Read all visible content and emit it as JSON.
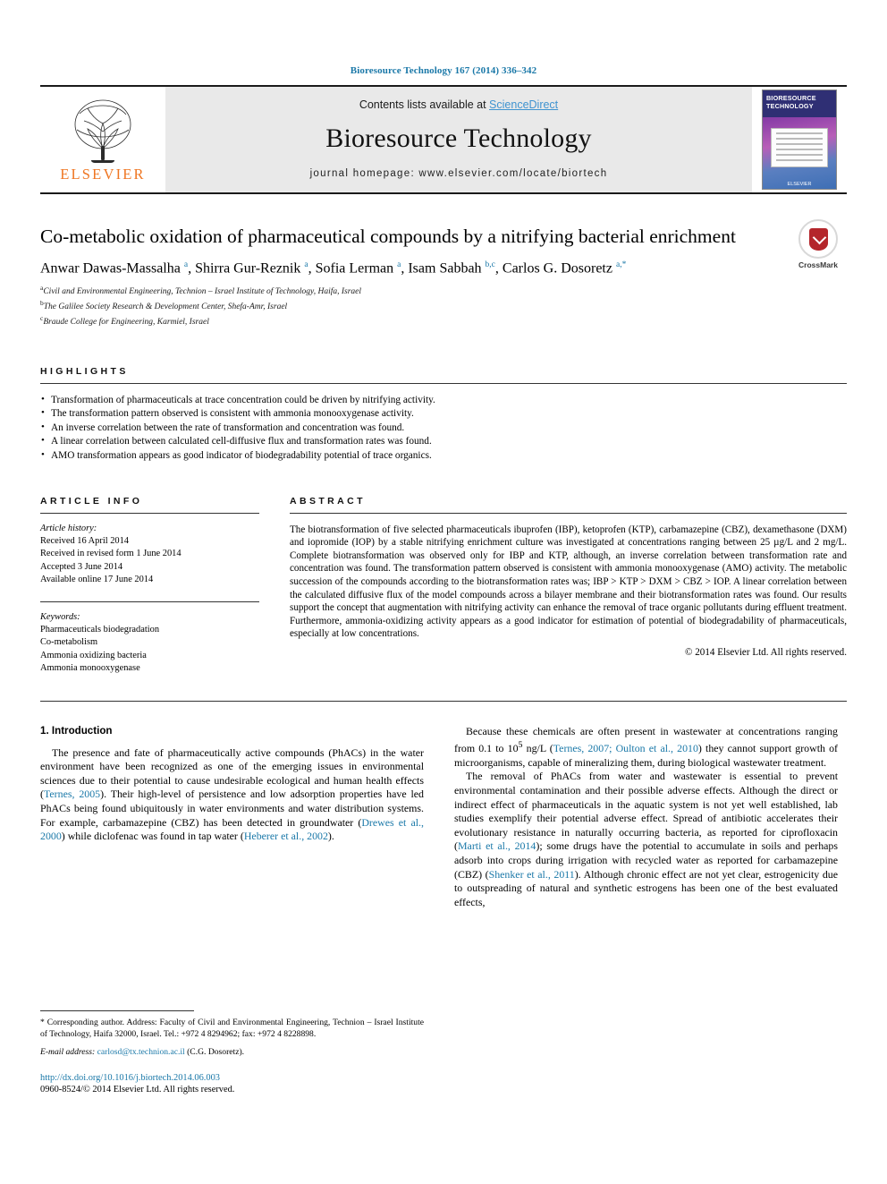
{
  "running_head": "Bioresource Technology 167 (2014) 336–342",
  "masthead": {
    "contents_prefix": "Contents lists available at ",
    "sciencedirect": "ScienceDirect",
    "journal_name": "Bioresource Technology",
    "homepage": "journal homepage: www.elsevier.com/locate/biortech",
    "publisher": "ELSEVIER",
    "cover_title": "BIORESOURCE TECHNOLOGY",
    "cover_footer": "ELSEVIER"
  },
  "article": {
    "title": "Co-metabolic oxidation of pharmaceutical compounds by a nitrifying bacterial enrichment",
    "crossmark_label": "CrossMark",
    "authors_html": "Anwar Dawas-Massalha <sup>a</sup>, Shirra Gur-Reznik <sup>a</sup>, Sofia Lerman <sup>a</sup>, Isam Sabbah <sup>b,c</sup>, Carlos G. Dosoretz <sup>a,</sup><sup class=\"star\">*</sup>",
    "affiliations": [
      {
        "marker": "a",
        "text": "Civil and Environmental Engineering, Technion – Israel Institute of Technology, Haifa, Israel"
      },
      {
        "marker": "b",
        "text": "The Galilee Society Research & Development Center, Shefa-Amr, Israel"
      },
      {
        "marker": "c",
        "text": "Braude College for Engineering, Karmiel, Israel"
      }
    ]
  },
  "highlights": {
    "heading": "HIGHLIGHTS",
    "items": [
      "Transformation of pharmaceuticals at trace concentration could be driven by nitrifying activity.",
      "The transformation pattern observed is consistent with ammonia monooxygenase activity.",
      "An inverse correlation between the rate of transformation and concentration was found.",
      "A linear correlation between calculated cell-diffusive flux and transformation rates was found.",
      "AMO transformation appears as good indicator of biodegradability potential of trace organics."
    ]
  },
  "article_info": {
    "heading": "ARTICLE INFO",
    "history_label": "Article history:",
    "history": [
      "Received 16 April 2014",
      "Received in revised form 1 June 2014",
      "Accepted 3 June 2014",
      "Available online 17 June 2014"
    ],
    "keywords_label": "Keywords:",
    "keywords": [
      "Pharmaceuticals biodegradation",
      "Co-metabolism",
      "Ammonia oxidizing bacteria",
      "Ammonia monooxygenase"
    ]
  },
  "abstract": {
    "heading": "ABSTRACT",
    "text": "The biotransformation of five selected pharmaceuticals ibuprofen (IBP), ketoprofen (KTP), carbamazepine (CBZ), dexamethasone (DXM) and iopromide (IOP) by a stable nitrifying enrichment culture was investigated at concentrations ranging between 25 µg/L and 2 mg/L. Complete biotransformation was observed only for IBP and KTP, although, an inverse correlation between transformation rate and concentration was found. The transformation pattern observed is consistent with ammonia monooxygenase (AMO) activity. The metabolic succession of the compounds according to the biotransformation rates was; IBP > KTP > DXM > CBZ > IOP. A linear correlation between the calculated diffusive flux of the model compounds across a bilayer membrane and their biotransformation rates was found. Our results support the concept that augmentation with nitrifying activity can enhance the removal of trace organic pollutants during effluent treatment. Furthermore, ammonia-oxidizing activity appears as a good indicator for estimation of potential of biodegradability of pharmaceuticals, especially at low concentrations.",
    "copyright": "© 2014 Elsevier Ltd. All rights reserved."
  },
  "body": {
    "section_heading": "1. Introduction",
    "left_paragraph_html": "The presence and fate of pharmaceutically active compounds (PhACs) in the water environment have been recognized as one of the emerging issues in environmental sciences due to their potential to cause undesirable ecological and human health effects (<a class=\"cite\" href=\"#\">Ternes, 2005</a>). Their high-level of persistence and low adsorption properties have led PhACs being found ubiquitously in water environments and water distribution systems. For example, carbamazepine (CBZ) has been detected in groundwater (<a class=\"cite\" href=\"#\">Drewes et al., 2000</a>) while diclofenac was found in tap water (<a class=\"cite\" href=\"#\">Heberer et al., 2002</a>).",
    "right_paragraph_1_html": "Because these chemicals are often present in wastewater at concentrations ranging from 0.1 to 10<sup>5</sup> ng/L (<a class=\"cite\" href=\"#\">Ternes, 2007; Oulton et al., 2010</a>) they cannot support growth of microorganisms, capable of mineralizing them, during biological wastewater treatment.",
    "right_paragraph_2_html": "The removal of PhACs from water and wastewater is essential to prevent environmental contamination and their possible adverse effects. Although the direct or indirect effect of pharmaceuticals in the aquatic system is not yet well established, lab studies exemplify their potential adverse effect. Spread of antibiotic accelerates their evolutionary resistance in naturally occurring bacteria, as reported for ciprofloxacin (<a class=\"cite\" href=\"#\">Marti et al., 2014</a>); some drugs have the potential to accumulate in soils and perhaps adsorb into crops during irrigation with recycled water as reported for carbamazepine (CBZ) (<a class=\"cite\" href=\"#\">Shenker et al., 2011</a>). Although chronic effect are not yet clear, estrogenicity due to outspreading of natural and synthetic estrogens has been one of the best evaluated effects,"
  },
  "footnote": {
    "corresponding_html": "* Corresponding author. Address: Faculty of Civil and Environmental Engineering, Technion – Israel Institute of Technology, Haifa 32000, Israel. Tel.: +972 4 8294962; fax: +972 4 8228898.",
    "email_label": "E-mail address:",
    "email": "carlosd@tx.technion.ac.il",
    "email_suffix": "(C.G. Dosoretz).",
    "doi": "http://dx.doi.org/10.1016/j.biortech.2014.06.003",
    "issn": "0960-8524/© 2014 Elsevier Ltd. All rights reserved."
  },
  "colors": {
    "link": "#1a78a8",
    "elsevier_orange": "#ef7622",
    "sciencedirect_blue": "#3f93d0"
  }
}
